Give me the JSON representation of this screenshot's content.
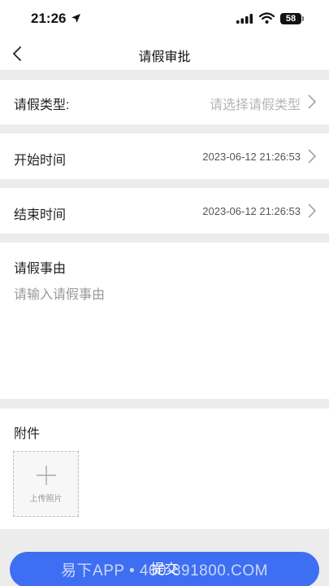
{
  "status_bar": {
    "time": "21:26",
    "battery": "58"
  },
  "nav": {
    "title": "请假审批"
  },
  "form": {
    "leave_type": {
      "label": "请假类型:",
      "placeholder": "请选择请假类型"
    },
    "start_time": {
      "label": "开始时间",
      "value": "2023-06-12 21:26:53"
    },
    "end_time": {
      "label": "结束时间",
      "value": "2023-06-12 21:26:53"
    },
    "reason": {
      "label": "请假事由",
      "placeholder": "请输入请假事由"
    },
    "attachment": {
      "label": "附件",
      "upload_label": "上传照片"
    }
  },
  "submit": {
    "label": "提交"
  },
  "watermark": {
    "text": "易下APP • 400-891800.COM"
  },
  "colors": {
    "accent": "#3e6ff2",
    "page_bg": "#ececec",
    "placeholder": "#b5b5b5"
  }
}
